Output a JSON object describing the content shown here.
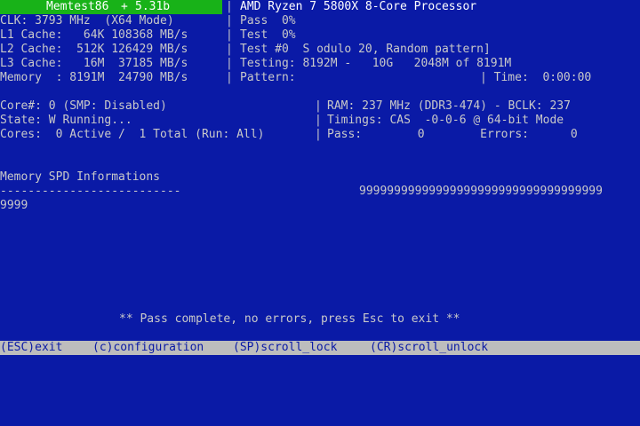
{
  "banner": {
    "title": "Memtest86",
    "plus": "+",
    "version": "5.31b"
  },
  "cpu_name": "AMD Ryzen 7 5800X 8-Core Processor",
  "left_block": [
    "CLK: 3793 MHz  (X64 Mode)",
    "L1 Cache:   64K 108368 MB/s",
    "L2 Cache:  512K 126429 MB/s",
    "L3 Cache:   16M  37185 MB/s",
    "Memory  : 8191M  24790 MB/s"
  ],
  "right_block": [
    "Pass  0%",
    "Test  0%",
    "Test #0  S odulo 20, Random pattern]",
    "Testing: 8192M -   10G   2048M of 8191M",
    "Pattern:"
  ],
  "time_label": "| Time:  0:00:00",
  "status_left": [
    "Core#: 0 (SMP: Disabled)",
    "State: W Running...",
    "Cores:  0 Active /  1 Total (Run: All)"
  ],
  "status_right": [
    "RAM: 237 MHz (DDR3-474) - BCLK: 237",
    "Timings: CAS  -0-0-6 @ 64-bit Mode",
    "Pass:        0        Errors:      0"
  ],
  "spd": {
    "heading": "Memory SPD Informations",
    "underline": "--------------------------",
    "nines_line1": "99999999999999999999999999999999999",
    "nines_line2": "9999"
  },
  "message": "** Pass complete, no errors, press Esc to exit **",
  "footer": {
    "exit": "(ESC)exit",
    "config": "(c)configuration",
    "scroll_lock": "(SP)scroll_lock",
    "scroll_unlock": "(CR)scroll_unlock"
  }
}
